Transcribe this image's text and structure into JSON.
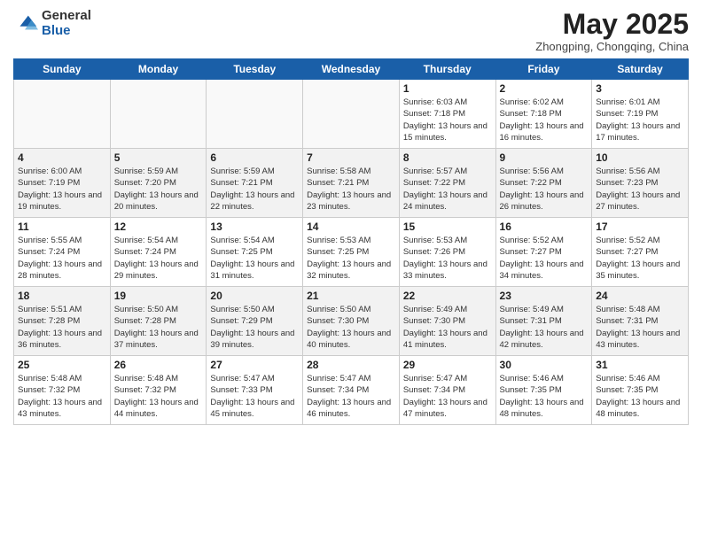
{
  "logo": {
    "general": "General",
    "blue": "Blue"
  },
  "title": "May 2025",
  "location": "Zhongping, Chongqing, China",
  "days_of_week": [
    "Sunday",
    "Monday",
    "Tuesday",
    "Wednesday",
    "Thursday",
    "Friday",
    "Saturday"
  ],
  "weeks": [
    {
      "parity": "odd",
      "days": [
        {
          "num": "",
          "empty": true
        },
        {
          "num": "",
          "empty": true
        },
        {
          "num": "",
          "empty": true
        },
        {
          "num": "",
          "empty": true
        },
        {
          "num": "1",
          "sunrise": "6:03 AM",
          "sunset": "7:18 PM",
          "daylight": "13 hours and 15 minutes."
        },
        {
          "num": "2",
          "sunrise": "6:02 AM",
          "sunset": "7:18 PM",
          "daylight": "13 hours and 16 minutes."
        },
        {
          "num": "3",
          "sunrise": "6:01 AM",
          "sunset": "7:19 PM",
          "daylight": "13 hours and 17 minutes."
        }
      ]
    },
    {
      "parity": "even",
      "days": [
        {
          "num": "4",
          "sunrise": "6:00 AM",
          "sunset": "7:19 PM",
          "daylight": "13 hours and 19 minutes."
        },
        {
          "num": "5",
          "sunrise": "5:59 AM",
          "sunset": "7:20 PM",
          "daylight": "13 hours and 20 minutes."
        },
        {
          "num": "6",
          "sunrise": "5:59 AM",
          "sunset": "7:21 PM",
          "daylight": "13 hours and 22 minutes."
        },
        {
          "num": "7",
          "sunrise": "5:58 AM",
          "sunset": "7:21 PM",
          "daylight": "13 hours and 23 minutes."
        },
        {
          "num": "8",
          "sunrise": "5:57 AM",
          "sunset": "7:22 PM",
          "daylight": "13 hours and 24 minutes."
        },
        {
          "num": "9",
          "sunrise": "5:56 AM",
          "sunset": "7:22 PM",
          "daylight": "13 hours and 26 minutes."
        },
        {
          "num": "10",
          "sunrise": "5:56 AM",
          "sunset": "7:23 PM",
          "daylight": "13 hours and 27 minutes."
        }
      ]
    },
    {
      "parity": "odd",
      "days": [
        {
          "num": "11",
          "sunrise": "5:55 AM",
          "sunset": "7:24 PM",
          "daylight": "13 hours and 28 minutes."
        },
        {
          "num": "12",
          "sunrise": "5:54 AM",
          "sunset": "7:24 PM",
          "daylight": "13 hours and 29 minutes."
        },
        {
          "num": "13",
          "sunrise": "5:54 AM",
          "sunset": "7:25 PM",
          "daylight": "13 hours and 31 minutes."
        },
        {
          "num": "14",
          "sunrise": "5:53 AM",
          "sunset": "7:25 PM",
          "daylight": "13 hours and 32 minutes."
        },
        {
          "num": "15",
          "sunrise": "5:53 AM",
          "sunset": "7:26 PM",
          "daylight": "13 hours and 33 minutes."
        },
        {
          "num": "16",
          "sunrise": "5:52 AM",
          "sunset": "7:27 PM",
          "daylight": "13 hours and 34 minutes."
        },
        {
          "num": "17",
          "sunrise": "5:52 AM",
          "sunset": "7:27 PM",
          "daylight": "13 hours and 35 minutes."
        }
      ]
    },
    {
      "parity": "even",
      "days": [
        {
          "num": "18",
          "sunrise": "5:51 AM",
          "sunset": "7:28 PM",
          "daylight": "13 hours and 36 minutes."
        },
        {
          "num": "19",
          "sunrise": "5:50 AM",
          "sunset": "7:28 PM",
          "daylight": "13 hours and 37 minutes."
        },
        {
          "num": "20",
          "sunrise": "5:50 AM",
          "sunset": "7:29 PM",
          "daylight": "13 hours and 39 minutes."
        },
        {
          "num": "21",
          "sunrise": "5:50 AM",
          "sunset": "7:30 PM",
          "daylight": "13 hours and 40 minutes."
        },
        {
          "num": "22",
          "sunrise": "5:49 AM",
          "sunset": "7:30 PM",
          "daylight": "13 hours and 41 minutes."
        },
        {
          "num": "23",
          "sunrise": "5:49 AM",
          "sunset": "7:31 PM",
          "daylight": "13 hours and 42 minutes."
        },
        {
          "num": "24",
          "sunrise": "5:48 AM",
          "sunset": "7:31 PM",
          "daylight": "13 hours and 43 minutes."
        }
      ]
    },
    {
      "parity": "odd",
      "days": [
        {
          "num": "25",
          "sunrise": "5:48 AM",
          "sunset": "7:32 PM",
          "daylight": "13 hours and 43 minutes."
        },
        {
          "num": "26",
          "sunrise": "5:48 AM",
          "sunset": "7:32 PM",
          "daylight": "13 hours and 44 minutes."
        },
        {
          "num": "27",
          "sunrise": "5:47 AM",
          "sunset": "7:33 PM",
          "daylight": "13 hours and 45 minutes."
        },
        {
          "num": "28",
          "sunrise": "5:47 AM",
          "sunset": "7:34 PM",
          "daylight": "13 hours and 46 minutes."
        },
        {
          "num": "29",
          "sunrise": "5:47 AM",
          "sunset": "7:34 PM",
          "daylight": "13 hours and 47 minutes."
        },
        {
          "num": "30",
          "sunrise": "5:46 AM",
          "sunset": "7:35 PM",
          "daylight": "13 hours and 48 minutes."
        },
        {
          "num": "31",
          "sunrise": "5:46 AM",
          "sunset": "7:35 PM",
          "daylight": "13 hours and 48 minutes."
        }
      ]
    }
  ]
}
